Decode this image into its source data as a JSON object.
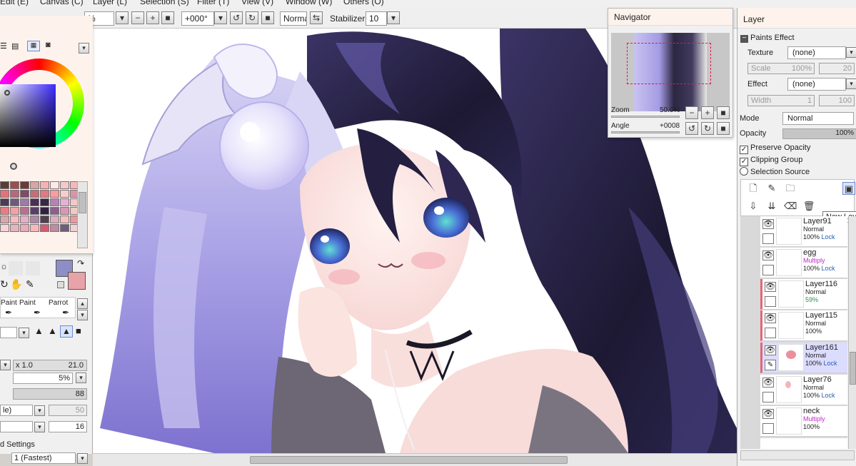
{
  "menu": {
    "items": [
      "Edit (E)",
      "Canvas (C)",
      "Layer (L)",
      "Selection (S)",
      "Filter (T)",
      "View (V)",
      "Window (W)",
      "Others (O)"
    ]
  },
  "toolbar": {
    "zoom_value": "%",
    "rotation_value": "+000°",
    "blend_mode": "Normal",
    "stabilizer_label": "Stabilizer",
    "stabilizer_value": "10"
  },
  "tools": {
    "brush_names": [
      "Paint",
      "Paint",
      "Parrot"
    ],
    "size_multiplier": "x 1.0",
    "size_value": "21.0",
    "min_size": "5%",
    "density": "88",
    "mode_select": "le)",
    "disabled_value": "50",
    "spacing_value": "16",
    "advanced_settings_label": "d Settings",
    "quality_value": "1 (Fastest)",
    "main_color": "#8f8dc5",
    "sub_color": "#e7a3a8"
  },
  "palette": [
    "#5a3d3a",
    "#9a4f4e",
    "#6c3a39",
    "#d6a5a5",
    "#f6b2b1",
    "#fde8e7",
    "#f3c9c9",
    "#f6b8b8",
    "#e27379",
    "#b36a7c",
    "#7c4c69",
    "#c36f79",
    "#dc7b83",
    "#fb9b9f",
    "#f8cdcc",
    "#d995a8",
    "#4a3c57",
    "#6e5a7e",
    "#a178ad",
    "#4a2f56",
    "#36284a",
    "#b781bb",
    "#e8b0d7",
    "#f5c7c8",
    "#ee7a81",
    "#f2a2a4",
    "#b9708f",
    "#583f68",
    "#30223f",
    "#8c5f8d",
    "#da96b4",
    "#f0cbc5",
    "#d8a7ae",
    "#f7bcbf",
    "#e2b1c7",
    "#ac8aa6",
    "#4f4052",
    "#d9aebd",
    "#f2c1bd",
    "#e59b9f",
    "#f7d2d6",
    "#e6b4c1",
    "#ecaaba",
    "#f7b8bd",
    "#d35b71",
    "#be8ba1",
    "#6d5e79",
    "#f3d1d1"
  ],
  "navigator": {
    "title": "Navigator",
    "zoom_label": "Zoom",
    "zoom_value": "50.0%",
    "angle_label": "Angle",
    "angle_value": "+0008"
  },
  "layer_panel": {
    "title": "Layer",
    "paints_effect_label": "Paints Effect",
    "texture_label": "Texture",
    "texture_value": "(none)",
    "scale_label": "Scale",
    "scale_value": "100%",
    "scale_value2": "20",
    "effect_label": "Effect",
    "effect_value": "(none)",
    "width_label": "Width",
    "width_value": "1",
    "width_value2": "100",
    "mode_label": "Mode",
    "mode_value": "Normal",
    "opacity_label": "Opacity",
    "opacity_value": "100%",
    "preserve_opacity": "Preserve Opacity",
    "clipping_group": "Clipping Group",
    "selection_source": "Selection Source",
    "tooltip": "New Laye",
    "layers": [
      {
        "name": "Layer91",
        "mode": "Normal",
        "opacity": "100%",
        "lock": "Lock"
      },
      {
        "name": "egg",
        "mode": "Multiply",
        "opacity": "100%",
        "lock": "Lock"
      },
      {
        "name": "Layer116",
        "mode": "Normal",
        "opacity": "59%",
        "lock": ""
      },
      {
        "name": "Layer115",
        "mode": "Normal",
        "opacity": "100%",
        "lock": ""
      },
      {
        "name": "Layer161",
        "mode": "Normal",
        "opacity": "100%",
        "lock": "Lock"
      },
      {
        "name": "Layer76",
        "mode": "Normal",
        "opacity": "100%",
        "lock": "Lock"
      },
      {
        "name": "neck",
        "mode": "Multiply",
        "opacity": "100%",
        "lock": ""
      }
    ]
  },
  "icons": {
    "new_layer": "new-layer-icon",
    "new_linework": "new-linework-icon",
    "new_folder": "new-folder-icon",
    "delete": "trash-icon",
    "eye": "eye-icon"
  }
}
